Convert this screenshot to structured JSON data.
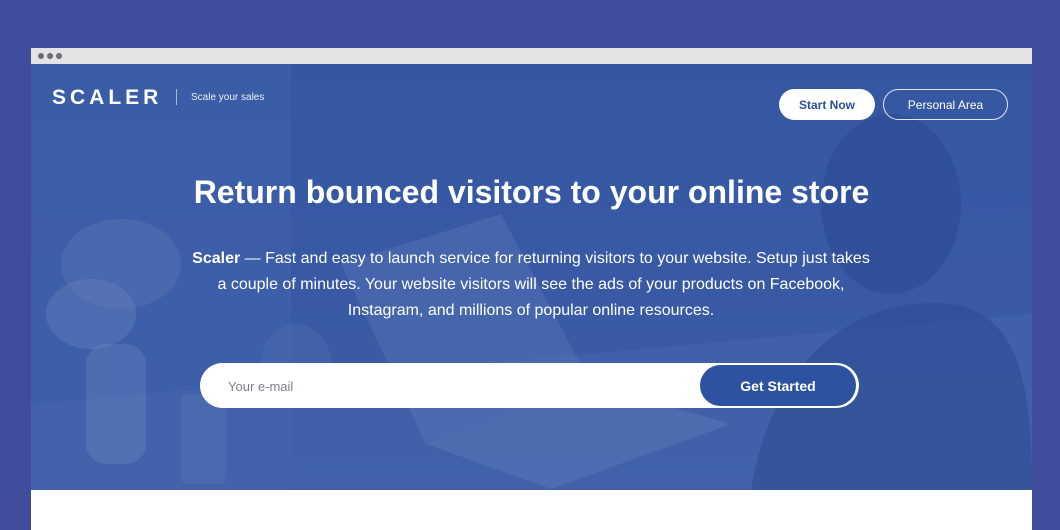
{
  "browser": {
    "window_dots": [
      "dot",
      "dot",
      "dot"
    ]
  },
  "header": {
    "logo": "SCALER",
    "tagline": "Scale your sales",
    "start_now_label": "Start Now",
    "personal_area_label": "Personal Area"
  },
  "hero": {
    "headline": "Return bounced visitors to your online store",
    "description_brand": "Scaler",
    "description_text": " — Fast and easy to launch service for returning visitors to your website. Setup just takes a couple of minutes. Your website visitors will see the ads of your products on Facebook, Instagram, and millions of popular online resources.",
    "email_placeholder": "Your e-mail",
    "get_started_label": "Get Started"
  },
  "colors": {
    "page_background": "#3f4d9c",
    "hero_blue": "#3a5ba3",
    "button_blue": "#2c52a0",
    "white": "#ffffff"
  }
}
